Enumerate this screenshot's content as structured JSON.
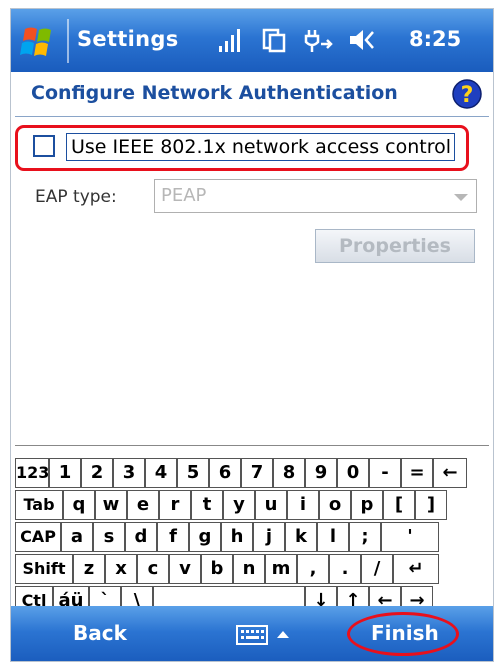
{
  "titlebar": {
    "title": "Settings",
    "time": "8:25",
    "icons": [
      "start-logo-icon",
      "signal-strength-icon",
      "connectivity-icon",
      "network-plug-icon",
      "speaker-icon"
    ]
  },
  "page": {
    "title": "Configure Network Authentication",
    "help_icon": "help-icon"
  },
  "checkbox": {
    "checked": false,
    "label": "Use IEEE 802.1x network access control"
  },
  "eap": {
    "label": "EAP type:",
    "value": "PEAP"
  },
  "properties_button": {
    "label": "Properties",
    "enabled": false
  },
  "keyboard": {
    "rows": [
      [
        "123",
        "1",
        "2",
        "3",
        "4",
        "5",
        "6",
        "7",
        "8",
        "9",
        "0",
        "-",
        "=",
        "←"
      ],
      [
        "Tab",
        "q",
        "w",
        "e",
        "r",
        "t",
        "y",
        "u",
        "i",
        "o",
        "p",
        "[",
        "]"
      ],
      [
        "CAP",
        "a",
        "s",
        "d",
        "f",
        "g",
        "h",
        "j",
        "k",
        "l",
        ";",
        "'"
      ],
      [
        "Shift",
        "z",
        "x",
        "c",
        "v",
        "b",
        "n",
        "m",
        ",",
        ".",
        "/",
        "↵"
      ],
      [
        "Ctl",
        "áü",
        "`",
        "\\",
        "",
        "↓",
        "↑",
        "←",
        "→"
      ]
    ]
  },
  "bottombar": {
    "left": "Back",
    "right": "Finish",
    "keyboard_icon": "keyboard-icon"
  },
  "colors": {
    "accent_blue": "#1c4f9f",
    "highlight_red": "#e8101c",
    "bar_blue": "#2b74d2"
  }
}
